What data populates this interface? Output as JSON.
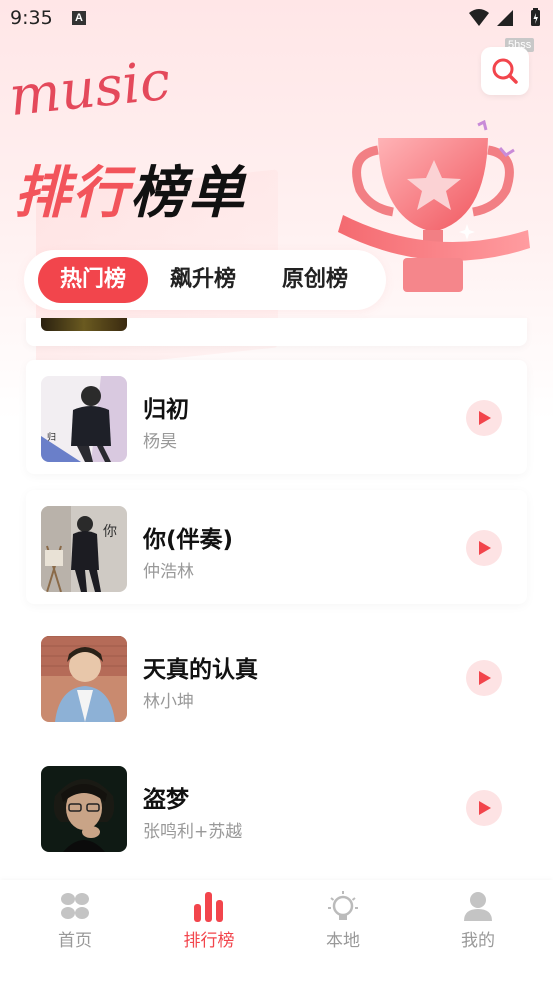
{
  "status_bar": {
    "time": "9:35",
    "notif_glyph": "A"
  },
  "watermark": "5hss",
  "logo_text": "music",
  "header": {
    "title_part1": "排行",
    "title_part2": "榜单",
    "search_icon": "search-icon"
  },
  "tabs": [
    {
      "label": "热门榜",
      "active": true
    },
    {
      "label": "飙升榜",
      "active": false
    },
    {
      "label": "原创榜",
      "active": false
    }
  ],
  "songs": [
    {
      "title": "归初",
      "artist": "杨昊"
    },
    {
      "title": "你(伴奏)",
      "artist": "仲浩林"
    },
    {
      "title": "天真的认真",
      "artist": "林小坤"
    },
    {
      "title": "盗梦",
      "artist": "张鸣利+苏越"
    }
  ],
  "bottom_nav": [
    {
      "label": "首页",
      "icon": "grid-icon",
      "active": false
    },
    {
      "label": "排行榜",
      "icon": "bar-chart-icon",
      "active": true
    },
    {
      "label": "本地",
      "icon": "lightbulb-icon",
      "active": false
    },
    {
      "label": "我的",
      "icon": "user-icon",
      "active": false
    }
  ],
  "colors": {
    "accent": "#f2454c",
    "accent_light": "#fde3e4",
    "background_top": "#ffe6e7"
  }
}
